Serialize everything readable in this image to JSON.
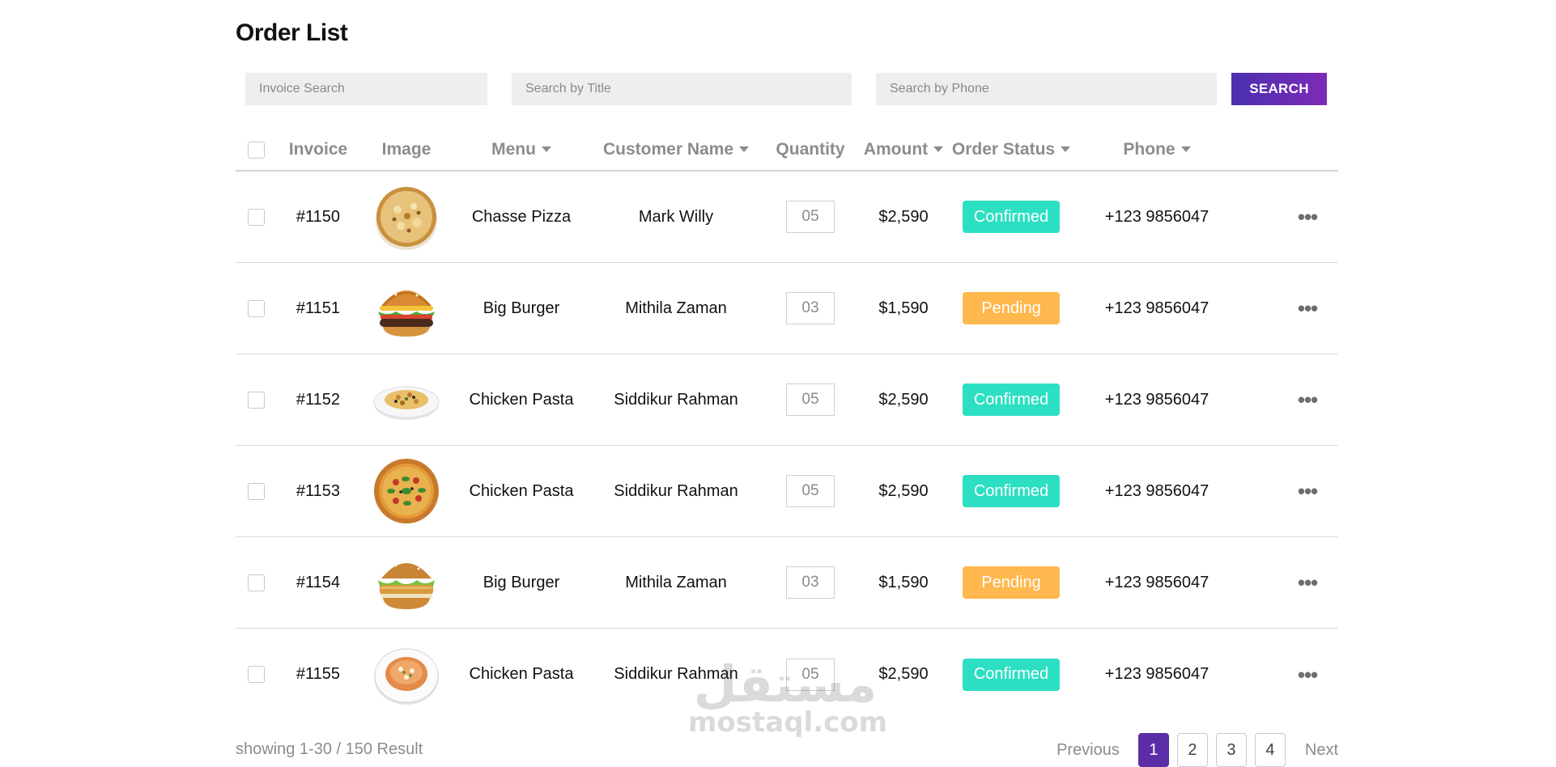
{
  "page": {
    "title": "Order List"
  },
  "filters": {
    "invoice_placeholder": "Invoice Search",
    "title_placeholder": "Search by Title",
    "phone_placeholder": "Search by Phone",
    "search_label": "SEARCH"
  },
  "columns": {
    "invoice": "Invoice",
    "image": "Image",
    "menu": "Menu",
    "customer": "Customer Name",
    "quantity": "Quantity",
    "amount": "Amount",
    "status": "Order Status",
    "phone": "Phone"
  },
  "orders": [
    {
      "invoice": "#1150",
      "image": "cheese-pizza-icon",
      "menu": "Chasse Pizza",
      "customer": "Mark Willy",
      "quantity": "05",
      "amount": "$2,590",
      "status": "Confirmed",
      "phone": "+123 9856047"
    },
    {
      "invoice": "#1151",
      "image": "burger-icon",
      "menu": "Big Burger",
      "customer": "Mithila Zaman",
      "quantity": "03",
      "amount": "$1,590",
      "status": "Pending",
      "phone": "+123 9856047"
    },
    {
      "invoice": "#1152",
      "image": "pasta-plate-icon",
      "menu": "Chicken Pasta",
      "customer": "Siddikur Rahman",
      "quantity": "05",
      "amount": "$2,590",
      "status": "Confirmed",
      "phone": "+123 9856047"
    },
    {
      "invoice": "#1153",
      "image": "veggie-pizza-icon",
      "menu": "Chicken Pasta",
      "customer": "Siddikur Rahman",
      "quantity": "05",
      "amount": "$2,590",
      "status": "Confirmed",
      "phone": "+123 9856047"
    },
    {
      "invoice": "#1154",
      "image": "chicken-burger-icon",
      "menu": "Big Burger",
      "customer": "Mithila Zaman",
      "quantity": "03",
      "amount": "$1,590",
      "status": "Pending",
      "phone": "+123 9856047"
    },
    {
      "invoice": "#1155",
      "image": "pasta-bowl-icon",
      "menu": "Chicken Pasta",
      "customer": "Siddikur Rahman",
      "quantity": "05",
      "amount": "$2,590",
      "status": "Confirmed",
      "phone": "+123 9856047"
    }
  ],
  "status_colors": {
    "Confirmed": "#2ddfc2",
    "Pending": "#ffb84d"
  },
  "footer": {
    "showing": "showing 1-30 / 150 Result",
    "previous": "Previous",
    "next": "Next",
    "pages": [
      "1",
      "2",
      "3",
      "4"
    ],
    "active_page": "1"
  },
  "watermark": {
    "arabic": "مستقل",
    "url": "mostaql.com"
  }
}
